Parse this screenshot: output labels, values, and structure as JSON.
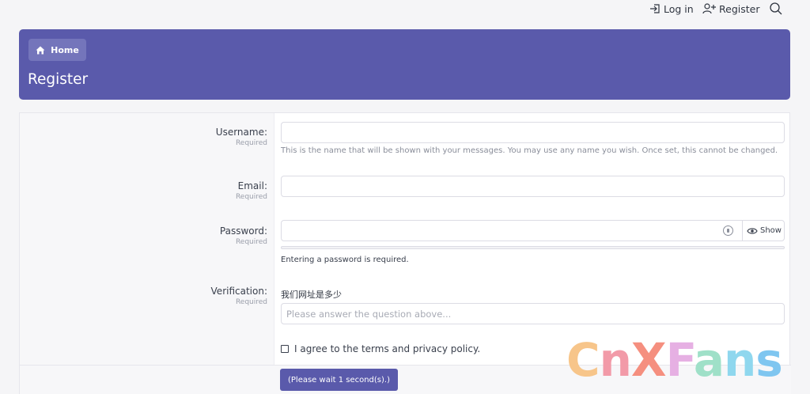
{
  "nav": {
    "login_label": "Log in",
    "register_label": "Register"
  },
  "header": {
    "breadcrumb_home": "Home",
    "title": "Register"
  },
  "form": {
    "username": {
      "label": "Username:",
      "required": "Required",
      "value": "",
      "hint": "This is the name that will be shown with your messages. You may use any name you wish. Once set, this cannot be changed."
    },
    "email": {
      "label": "Email:",
      "required": "Required",
      "value": ""
    },
    "password": {
      "label": "Password:",
      "required": "Required",
      "value": "",
      "show_label": "Show",
      "message": "Entering a password is required."
    },
    "verification": {
      "label": "Verification:",
      "required": "Required",
      "question": "我们网址是多少",
      "placeholder": "Please answer the question above..."
    },
    "terms_label": "I agree to the terms and privacy policy.",
    "submit_label": "(Please wait 1 second(s).)"
  },
  "watermark": {
    "text": "CnXFans"
  },
  "colors": {
    "accent": "#5a5aab",
    "background": "#f5f5f7"
  }
}
